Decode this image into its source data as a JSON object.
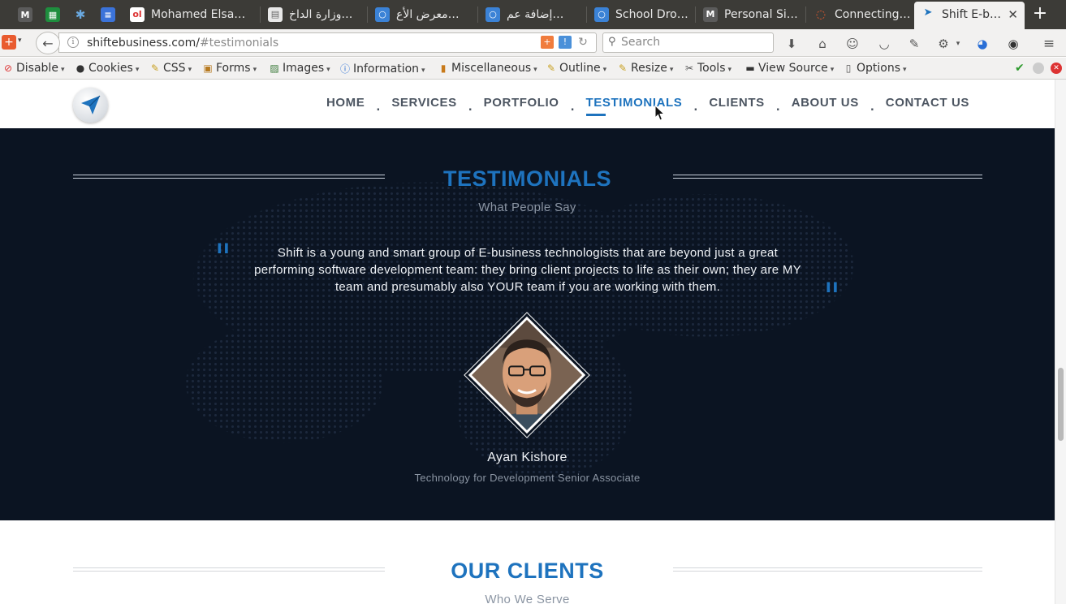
{
  "browser": {
    "tabs": [
      {
        "title": "",
        "icon": "gmail-icon"
      },
      {
        "title": "",
        "icon": "sheets-icon"
      },
      {
        "title": "",
        "icon": "snowflake-icon"
      },
      {
        "title": "",
        "icon": "docs-icon"
      },
      {
        "title": "Mohamed Elsa…",
        "icon": "olx-icon"
      },
      {
        "title": "وزارة الداخ…",
        "icon": "document-icon"
      },
      {
        "title": "معرض الأع…",
        "icon": "browser-icon"
      },
      {
        "title": "إضافة عم…",
        "icon": "browser-icon"
      },
      {
        "title": "School Dro…",
        "icon": "browser-icon"
      },
      {
        "title": "Personal Si…",
        "icon": "gmail-icon"
      },
      {
        "title": "Connecting…",
        "icon": "loading-icon"
      },
      {
        "title": "Shift E-b…",
        "icon": "shift-logo-icon",
        "active": true
      }
    ],
    "new_tab": "+",
    "close_glyph": "✕",
    "url": {
      "domain": "shiftebusiness.com/",
      "hash": "#testimonials"
    },
    "search_placeholder": "Search"
  },
  "devtoolbar": {
    "items": [
      {
        "label": "Disable",
        "icon": "disable-icon"
      },
      {
        "label": "Cookies",
        "icon": "cookies-icon"
      },
      {
        "label": "CSS",
        "icon": "css-icon"
      },
      {
        "label": "Forms",
        "icon": "forms-icon"
      },
      {
        "label": "Images",
        "icon": "images-icon"
      },
      {
        "label": "Information",
        "icon": "information-icon"
      },
      {
        "label": "Miscellaneous",
        "icon": "miscellaneous-icon"
      },
      {
        "label": "Outline",
        "icon": "outline-icon"
      },
      {
        "label": "Resize",
        "icon": "resize-icon"
      },
      {
        "label": "Tools",
        "icon": "tools-icon"
      },
      {
        "label": "View Source",
        "icon": "view-source-icon"
      },
      {
        "label": "Options",
        "icon": "options-icon"
      }
    ]
  },
  "site": {
    "nav": [
      {
        "label": "HOME"
      },
      {
        "label": "SERVICES"
      },
      {
        "label": "PORTFOLIO"
      },
      {
        "label": "TESTIMONIALS",
        "active": true
      },
      {
        "label": "CLIENTS"
      },
      {
        "label": "ABOUT US"
      },
      {
        "label": "CONTACT US"
      }
    ],
    "nav_separator": ".",
    "testimonials": {
      "title": "TESTIMONIALS",
      "subtitle": "What People Say",
      "open_quote": "\"",
      "close_quote": "\"",
      "quote": "Shift is a young and smart group of E-business technologists that are beyond just a great performing software development team: they bring client projects to life as their own; they are MY team and presumably also YOUR team if you are working with them.",
      "name": "Ayan Kishore",
      "role": "Technology for Development Senior Associate"
    },
    "clients": {
      "title": "OUR CLIENTS",
      "subtitle": "Who We Serve"
    }
  },
  "colors": {
    "accent": "#1e73be",
    "section_bg": "#0b1422",
    "nav_text": "#4c5561"
  }
}
